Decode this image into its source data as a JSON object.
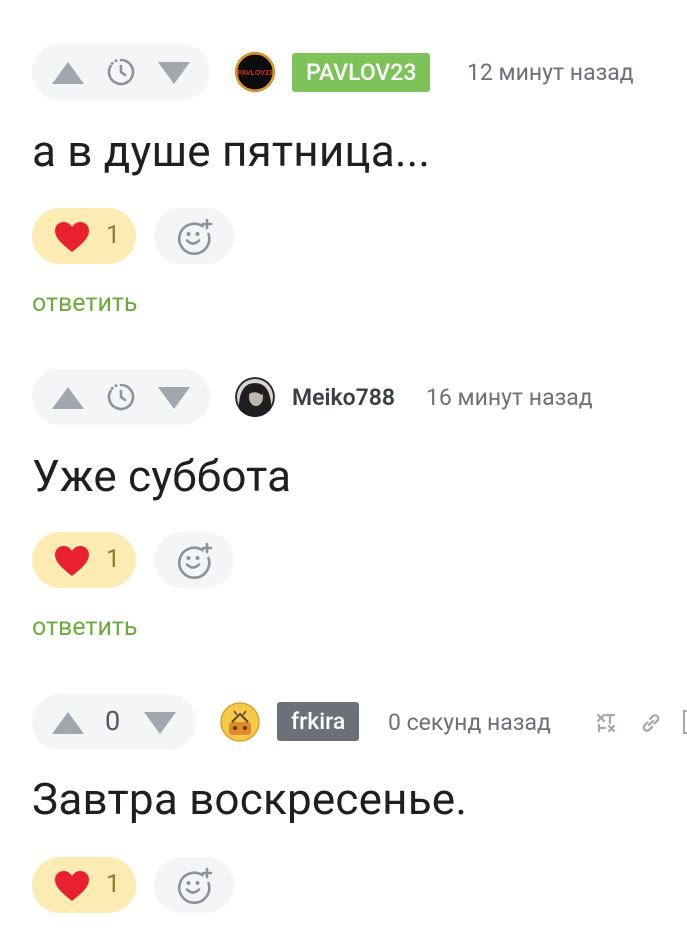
{
  "comments": [
    {
      "author": "PAVLOV23",
      "author_style": "tag-green",
      "avatar_text": "PAVLOV23",
      "time": "12 минут назад",
      "text": "а в душе пятница...",
      "likes": "1",
      "reply_label": "ответить"
    },
    {
      "author": "Meiko788",
      "author_style": "plain",
      "time": "16 минут назад",
      "text": "Уже суббота",
      "likes": "1",
      "reply_label": "ответить"
    },
    {
      "author": "frkira",
      "author_style": "tag-gray",
      "score": "0",
      "time": "0 секунд назад",
      "text": "Завтра воскресенье.",
      "likes": "1"
    }
  ],
  "colors": {
    "author_tag_green": "#7dc35a",
    "author_tag_gray": "#6d7079",
    "like_bg": "#fcebb2",
    "heart": "#e8202f",
    "reply_link": "#6cab3f"
  }
}
